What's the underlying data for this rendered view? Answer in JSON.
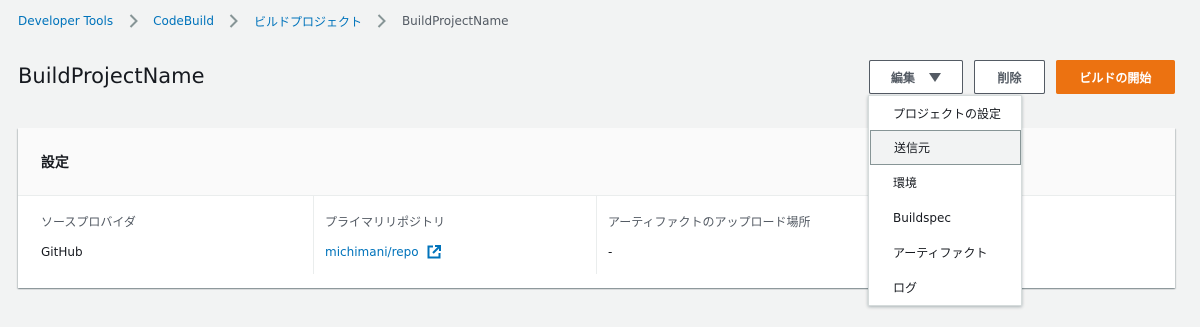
{
  "breadcrumb": {
    "items": [
      "Developer Tools",
      "CodeBuild",
      "ビルドプロジェクト"
    ],
    "current": "BuildProjectName"
  },
  "header": {
    "title": "BuildProjectName",
    "edit_label": "編集",
    "delete_label": "削除",
    "start_label": "ビルドの開始"
  },
  "settings": {
    "title": "設定",
    "source_provider_label": "ソースプロバイダ",
    "source_provider_value": "GitHub",
    "primary_repo_label": "プライマリリポジトリ",
    "primary_repo_value": "michimani/repo",
    "artifact_upload_label": "アーティファクトのアップロード場所",
    "artifact_upload_value": "-"
  },
  "edit_menu": {
    "items": [
      "プロジェクトの設定",
      "送信元",
      "環境",
      "Buildspec",
      "アーティファクト",
      "ログ"
    ],
    "highlighted": "送信元"
  },
  "colors": {
    "link": "#0073bb",
    "primary_button": "#ec7211",
    "background": "#f2f3f3"
  }
}
